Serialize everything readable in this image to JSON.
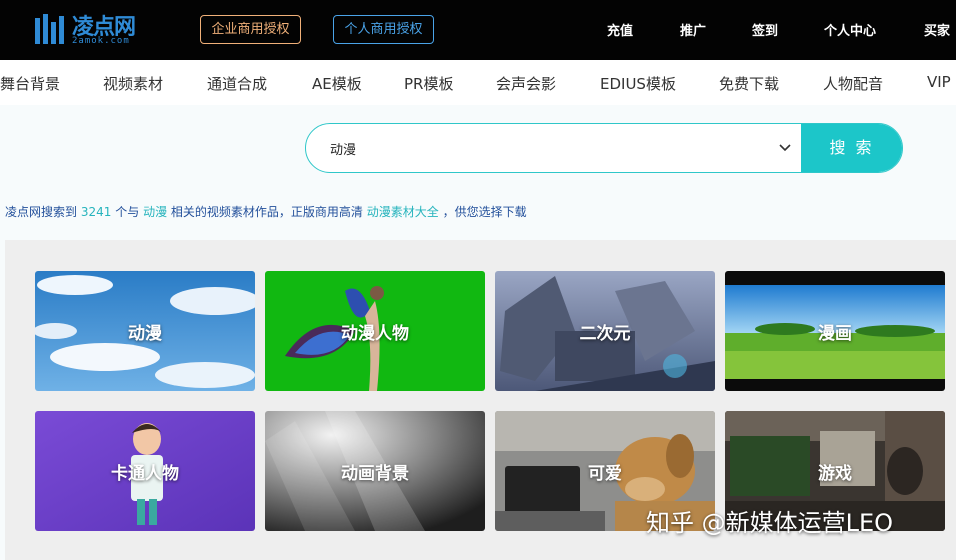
{
  "header": {
    "logo_text": "凌点网",
    "logo_sub": "2amok.com",
    "license_buttons": [
      "企业商用授权",
      "个人商用授权"
    ],
    "nav": [
      "充值",
      "推广",
      "签到",
      "个人中心",
      "买家"
    ]
  },
  "categories": [
    "舞台背景",
    "视频素材",
    "通道合成",
    "AE模板",
    "PR模板",
    "会声会影",
    "EDIUS模板",
    "免费下载",
    "人物配音",
    "VIP"
  ],
  "search": {
    "value": "动漫",
    "button_label": "搜索",
    "caret_icon": "chevron-down-icon"
  },
  "summary": {
    "prefix": "凌点网搜索到",
    "count": "3241",
    "mid": "个与",
    "keyword": "动漫",
    "mid2": "相关的视频素材作品，正版商用高清",
    "link": "动漫素材大全",
    "suffix": "，供您选择下载"
  },
  "tiles": [
    {
      "label": "动漫",
      "art": "sky-clouds"
    },
    {
      "label": "动漫人物",
      "art": "green-screen-butterfly"
    },
    {
      "label": "二次元",
      "art": "fantasy-ruins"
    },
    {
      "label": "漫画",
      "art": "grassland-sky"
    },
    {
      "label": "卡通人物",
      "art": "cartoon-boy"
    },
    {
      "label": "动画背景",
      "art": "gray-light-rays"
    },
    {
      "label": "可爱",
      "art": "dog-laptop"
    },
    {
      "label": "游戏",
      "art": "gaming-room"
    }
  ],
  "watermark": "知乎 @新媒体运营LEO",
  "colors": {
    "accent": "#1cc6c9",
    "header_bg": "#030303",
    "biz_license": "#f0b079",
    "personal_license": "#4aa3e8",
    "summary_text": "#23509b"
  }
}
